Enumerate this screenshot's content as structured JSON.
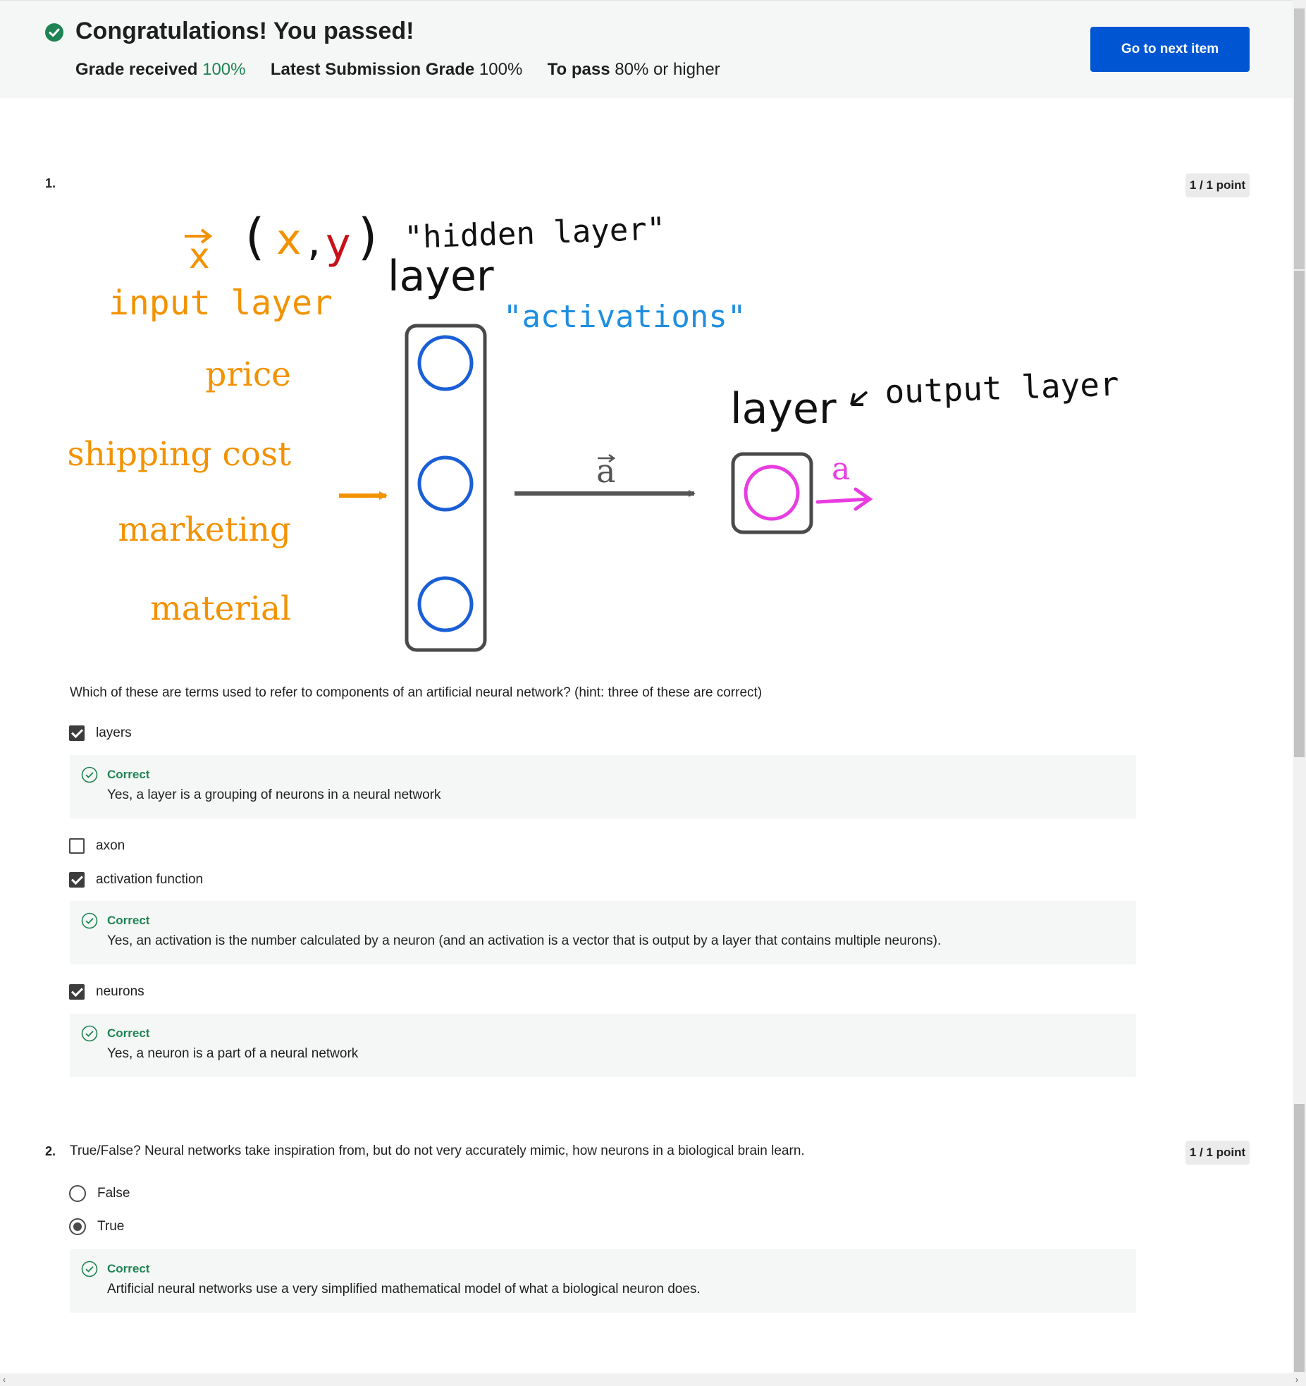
{
  "banner": {
    "title": "Congratulations! You passed!",
    "grade_received_label": "Grade received",
    "grade_received_value": "100%",
    "latest_label": "Latest Submission Grade",
    "latest_value": "100%",
    "to_pass_label": "To pass",
    "to_pass_value": "80% or higher",
    "next_button": "Go to next item",
    "accent_color": "#1f8354",
    "button_color": "#0056d2"
  },
  "q1": {
    "number": "1.",
    "points": "1 / 1 point",
    "figure": {
      "x_vec": "x",
      "xy_open": "(",
      "xy_x": "x",
      "xy_comma": ",",
      "xy_y": "y",
      "xy_close": ")",
      "hidden_label": "\"hidden layer\"",
      "layer_label_1": "layer",
      "input_layer_label": "input layer",
      "activations_label": "\"activations\"",
      "features": [
        "price",
        "shipping cost",
        "marketing",
        "material"
      ],
      "a_vec_label": "a",
      "layer_label_2": "layer",
      "output_layer_label": "output layer",
      "a_out_label": "a"
    },
    "question": "Which of these are terms used to refer to components of an artificial neural network? (hint: three of these are correct)",
    "options": [
      {
        "label": "layers",
        "checked": true
      },
      {
        "label": "axon",
        "checked": false
      },
      {
        "label": "activation function",
        "checked": true
      },
      {
        "label": "neurons",
        "checked": true
      }
    ],
    "feedback": [
      {
        "head": "Correct",
        "text": "Yes, a layer is a grouping of neurons in a neural network"
      },
      {
        "head": "Correct",
        "text": "Yes, an activation is the number calculated by a neuron (and an activation is a vector that is output by a layer that contains multiple neurons)."
      },
      {
        "head": "Correct",
        "text": "Yes, a neuron is a part of a neural network"
      }
    ]
  },
  "q2": {
    "number": "2.",
    "points": "1 / 1 point",
    "question": "True/False? Neural networks take inspiration from, but do not very accurately mimic, how neurons in a biological brain learn.",
    "options": [
      {
        "label": "False",
        "selected": false
      },
      {
        "label": "True",
        "selected": true
      }
    ],
    "feedback": {
      "head": "Correct",
      "text": "Artificial neural networks use a very simplified mathematical model of what a biological neuron does."
    }
  }
}
